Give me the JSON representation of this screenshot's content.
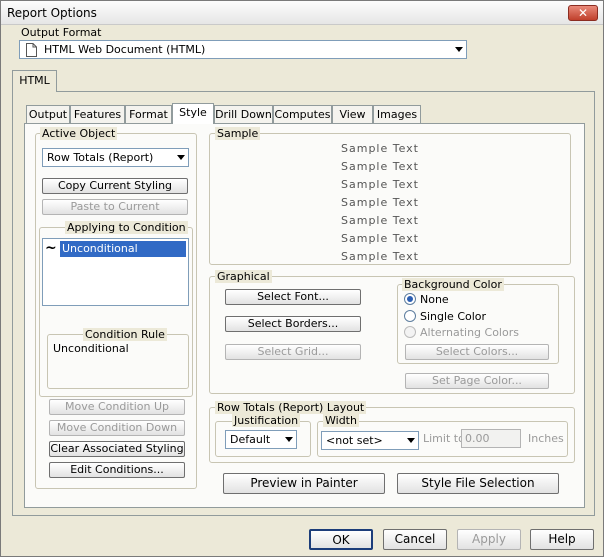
{
  "window": {
    "title": "Report Options",
    "close_glyph": "✕"
  },
  "output_format": {
    "label": "Output Format",
    "value": "HTML Web Document (HTML)"
  },
  "outer_tab": "HTML",
  "tabs": [
    "Output",
    "Features",
    "Format",
    "Style",
    "Drill Down",
    "Computes",
    "View",
    "Images"
  ],
  "active_tab": "Style",
  "active_object": {
    "label": "Active Object",
    "value": "Row Totals (Report)",
    "copy_button": "Copy Current Styling",
    "paste_button": "Paste to Current"
  },
  "conditions": {
    "label": "Applying to Condition",
    "items": [
      "Unconditional"
    ],
    "rule_label": "Condition Rule",
    "rule_text": "Unconditional",
    "move_up": "Move Condition Up",
    "move_down": "Move Condition Down",
    "clear_button": "Clear Associated Styling",
    "edit_button": "Edit Conditions..."
  },
  "sample": {
    "label": "Sample",
    "lines": [
      "Sample Text",
      "Sample Text",
      "Sample Text",
      "Sample Text",
      "Sample Text",
      "Sample Text",
      "Sample Text"
    ]
  },
  "graphical": {
    "label": "Graphical",
    "select_font": "Select Font...",
    "select_borders": "Select Borders...",
    "select_grid": "Select Grid...",
    "background_label": "Background Color",
    "bg_none": "None",
    "bg_single": "Single Color",
    "bg_alternating": "Alternating Colors",
    "bg_selected": "None",
    "select_colors": "Select Colors...",
    "set_page_color": "Set Page Color..."
  },
  "layout": {
    "label": "Row Totals (Report) Layout",
    "justification_label": "Justification",
    "justification_value": "Default",
    "width_label": "Width",
    "width_value": "<not set>",
    "limit_label": "Limit to",
    "limit_value": "0.00",
    "unit": "Inches"
  },
  "actions": {
    "preview": "Preview in Painter",
    "style_file": "Style File Selection"
  },
  "footer": {
    "ok": "OK",
    "cancel": "Cancel",
    "apply": "Apply",
    "help": "Help"
  }
}
